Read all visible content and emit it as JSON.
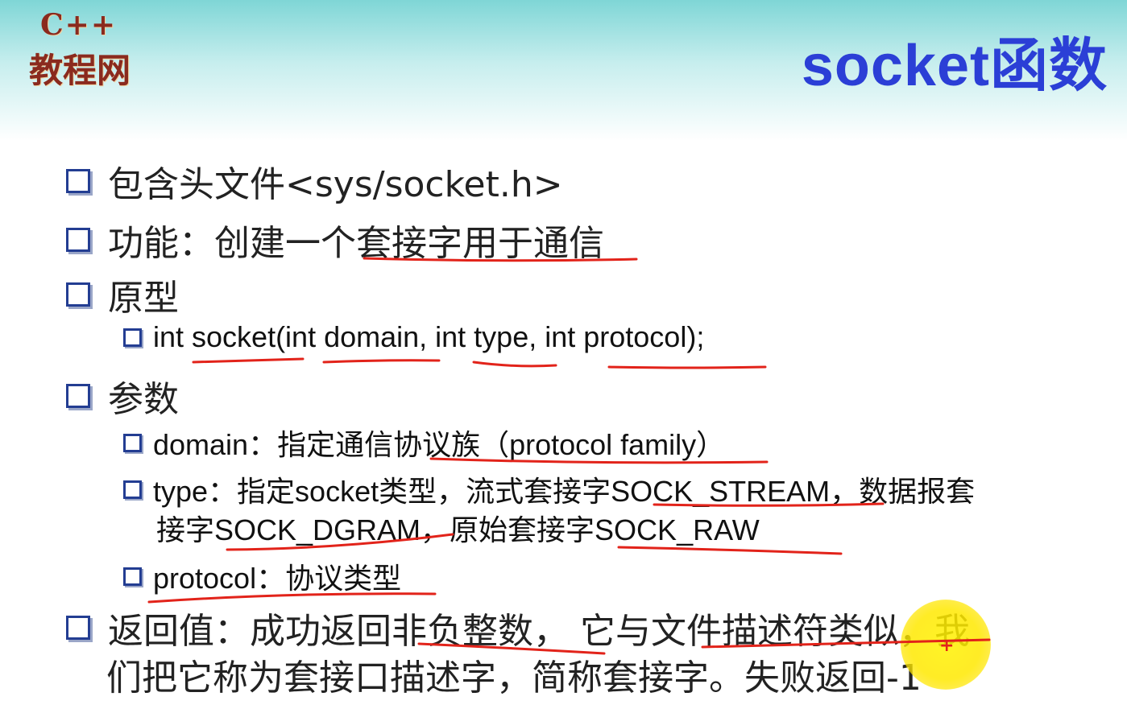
{
  "logo": {
    "top": "C++",
    "bottom": "教程网"
  },
  "title": "socket函数",
  "bullets": {
    "include": "包含头文件<sys/socket.h>",
    "function": "功能：创建一个套接字用于通信",
    "prototype": "原型",
    "prototype_code": "int socket(int domain, int type, int protocol);",
    "params": "参数",
    "param_domain": "domain：指定通信协议族（protocol family）",
    "param_type_line1": "type：指定socket类型，流式套接字SOCK_STREAM，数据报套",
    "param_type_line2": "接字SOCK_DGRAM，原始套接字SOCK_RAW",
    "param_protocol": "protocol：协议类型",
    "return_line1": "返回值：成功返回非负整数，  它与文件描述符类似，我",
    "return_line2": "们把它称为套接口描述字，简称套接字。失败返回-1"
  },
  "colors": {
    "title": "#2b3fd6",
    "bullet_box": "#233d92",
    "annotation": "#e2231a",
    "pointer": "#fff200"
  },
  "icons": {
    "bullet": "checkbox-square-icon",
    "pointer": "pen-cursor-icon"
  }
}
